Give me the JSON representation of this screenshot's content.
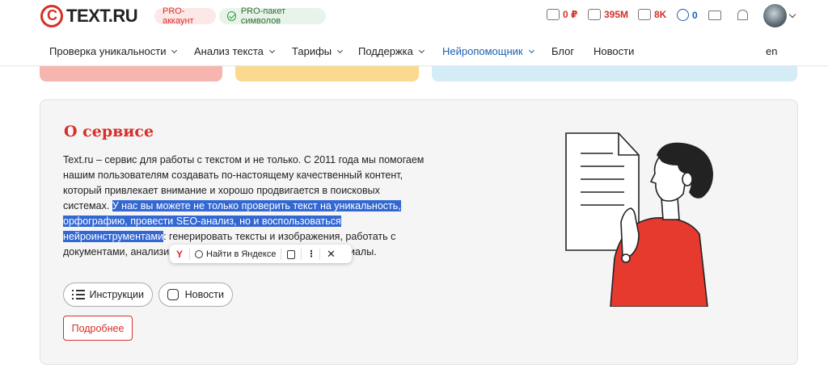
{
  "header": {
    "logo_text": "TEXT.RU",
    "pro_account": "PRO-аккаунт",
    "pro_package": "PRO-пакет символов",
    "balance": "0 ₽",
    "symbols": "395M",
    "k_count": "8K",
    "n_count": "0"
  },
  "nav": {
    "items": [
      {
        "label": "Проверка уникальности"
      },
      {
        "label": "Анализ текста"
      },
      {
        "label": "Тарифы"
      },
      {
        "label": "Поддержка"
      },
      {
        "label": "Нейропомощник"
      },
      {
        "label": "Блог"
      },
      {
        "label": "Новости"
      }
    ],
    "lang": "en"
  },
  "card": {
    "title": "О сервисе",
    "text_before": "Text.ru – сервис для работы с текстом и не только. С 2011 года мы помогаем нашим пользователям создавать по-настоящему качественный контент, который привлекает внимание и хорошо продвигается в поисковых системах. ",
    "text_selected": "У нас вы можете не только проверить текст на уникальность, орфографию, провести SEO-анализ, но и воспользоваться нейроинструментами",
    "text_after": ": генерировать тексты и изображения, работать с документами, анализировать и обрабатывать готовые материалы.",
    "btn_instructions": "Инструкции",
    "btn_news": "Новости",
    "btn_more": "Подробнее"
  },
  "popup": {
    "yandex_logo": "Y",
    "find_label": "Найти в Яндексе",
    "more": "⋮",
    "close": "✕"
  },
  "colors": {
    "brand_red": "#d62f2a",
    "link_blue": "#1a5fb4",
    "selection": "#3368d3"
  }
}
